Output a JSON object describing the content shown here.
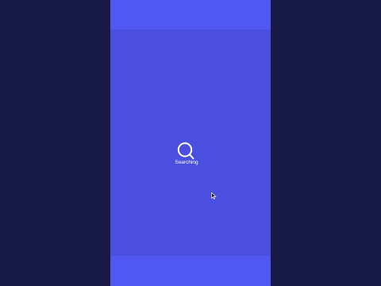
{
  "colors": {
    "background": "#161a45",
    "panel": "#4a4fe0",
    "bars": "#5158f2",
    "icon": "#ffffff"
  },
  "loader": {
    "icon": "search-icon",
    "status_text": "Searching"
  },
  "cursor": {
    "icon": "mouse-pointer-icon"
  }
}
